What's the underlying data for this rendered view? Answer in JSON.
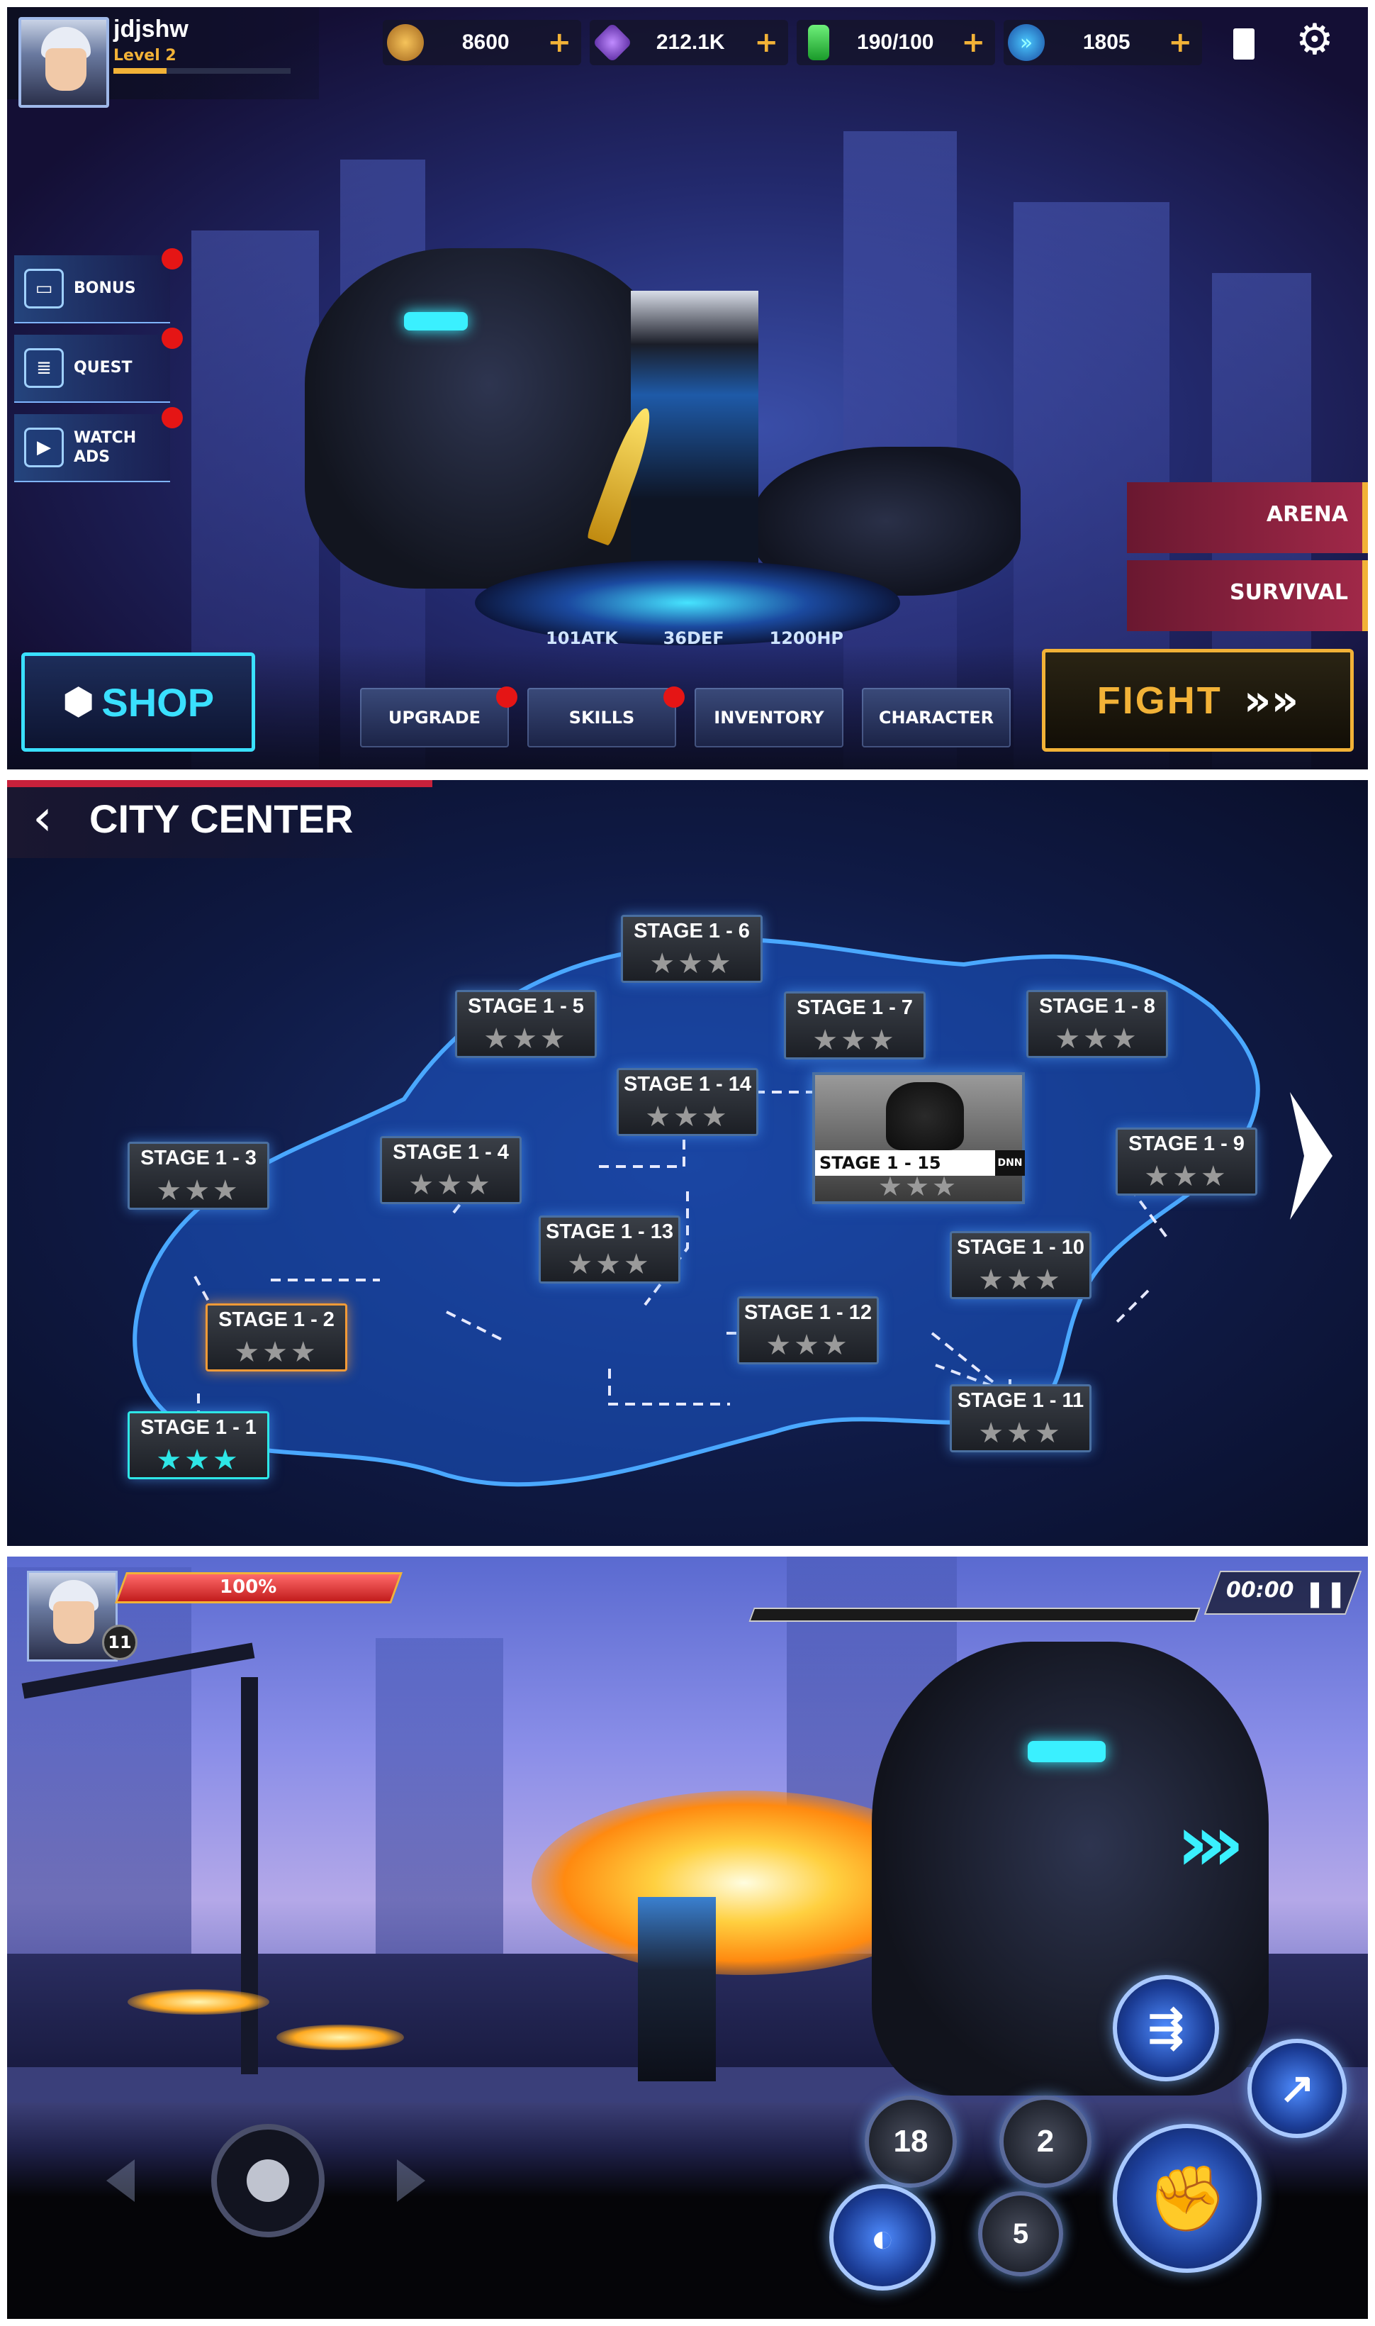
{
  "home": {
    "player": {
      "name": "jdjshw",
      "level": "Level 2"
    },
    "resources": [
      {
        "icon": "coin-icon",
        "value": "8600",
        "plus": "+"
      },
      {
        "icon": "gem-icon",
        "value": "212.1K",
        "plus": "+"
      },
      {
        "icon": "energy-battery-icon",
        "value": "190/100",
        "plus": "+"
      },
      {
        "icon": "ticket-icon",
        "value": "1805",
        "plus": "+"
      }
    ],
    "side_menu": [
      {
        "label": "BONUS",
        "icon": "car-icon"
      },
      {
        "label": "QUEST",
        "icon": "list-icon"
      },
      {
        "label": "WATCH ADS",
        "icon": "video-icon"
      }
    ],
    "stats": {
      "atk": "101ATK",
      "def": "36DEF",
      "hp": "1200HP"
    },
    "modes": {
      "arena": "ARENA",
      "survival": "SURVIVAL"
    },
    "shop_label": "SHOP",
    "tabs": [
      "UPGRADE",
      "SKILLS",
      "INVENTORY",
      "CHARACTER"
    ],
    "fight_label": "FIGHT",
    "fight_arrows": "»»"
  },
  "map": {
    "title": "CITY CENTER",
    "stages": [
      {
        "label": "STAGE 1 - 1",
        "stars": "★★★",
        "cleared": true
      },
      {
        "label": "STAGE 1 - 2",
        "stars": "★★★",
        "selected": true
      },
      {
        "label": "STAGE 1 - 3",
        "stars": "★★★"
      },
      {
        "label": "STAGE 1 - 4",
        "stars": "★★★"
      },
      {
        "label": "STAGE 1 - 5",
        "stars": "★★★"
      },
      {
        "label": "STAGE 1 - 6",
        "stars": "★★★"
      },
      {
        "label": "STAGE 1 - 7",
        "stars": "★★★"
      },
      {
        "label": "STAGE 1 - 8",
        "stars": "★★★"
      },
      {
        "label": "STAGE 1 - 9",
        "stars": "★★★"
      },
      {
        "label": "STAGE 1 - 10",
        "stars": "★★★"
      },
      {
        "label": "STAGE 1 - 11",
        "stars": "★★★"
      },
      {
        "label": "STAGE 1 - 12",
        "stars": "★★★"
      },
      {
        "label": "STAGE 1 - 13",
        "stars": "★★★"
      },
      {
        "label": "STAGE 1 - 14",
        "stars": "★★★"
      },
      {
        "label": "STAGE 1 - 15",
        "stars": "★★★",
        "boss": true,
        "badge": "DNN"
      }
    ]
  },
  "battle": {
    "hp_percent": "100%",
    "hp_fraction": 1.0,
    "player_level": "11",
    "timer": "00:00",
    "skill_counts": {
      "skill_a": "18",
      "skill_b": "2",
      "skill_c": "5"
    }
  },
  "colors": {
    "gold": "#f2b237",
    "cyan": "#2ee6e6",
    "red_dot": "#e51515",
    "hp_red": "#e23434"
  }
}
